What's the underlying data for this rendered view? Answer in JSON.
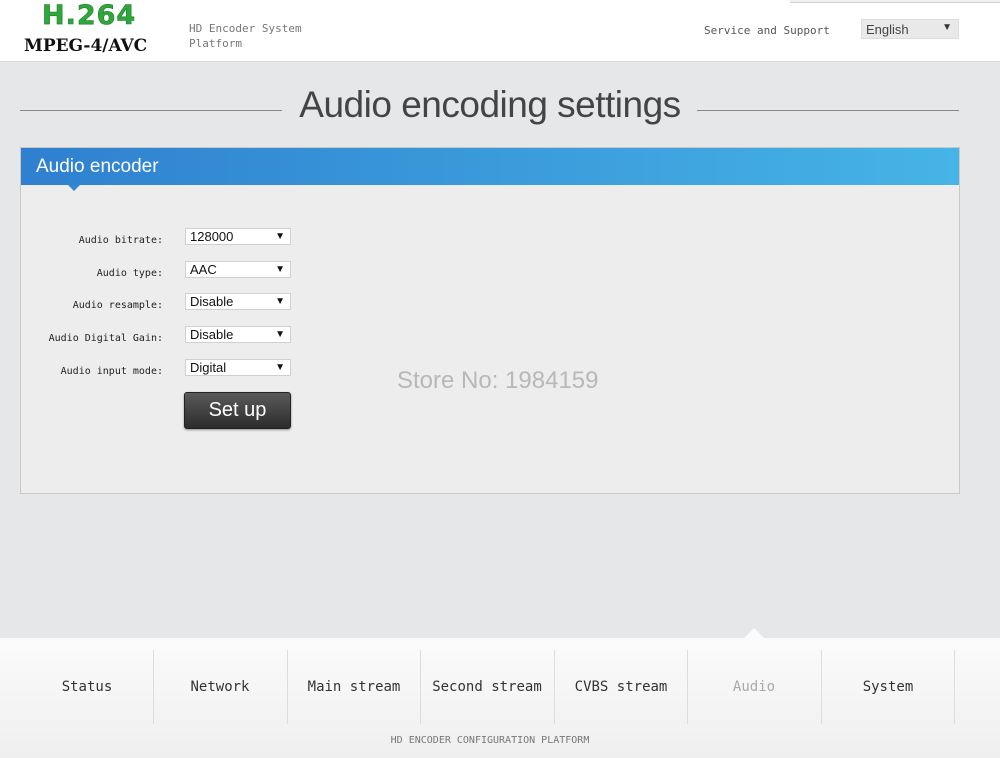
{
  "header": {
    "logo_main": "H.264",
    "logo_sub": "MPEG-4/AVC",
    "platform_line1": "HD Encoder System",
    "platform_line2": "Platform",
    "support_link": "Service and Support",
    "language": "English"
  },
  "page": {
    "title": "Audio encoding settings"
  },
  "panel": {
    "title": "Audio encoder",
    "fields": [
      {
        "label": "Audio bitrate:",
        "value": "128000"
      },
      {
        "label": "Audio type:",
        "value": "AAC"
      },
      {
        "label": "Audio resample:",
        "value": "Disable"
      },
      {
        "label": "Audio Digital Gain:",
        "value": "Disable"
      },
      {
        "label": "Audio input mode:",
        "value": "Digital"
      }
    ],
    "submit_label": "Set up",
    "watermark": "Store No: 1984159"
  },
  "nav": {
    "items": [
      {
        "label": "Status"
      },
      {
        "label": "Network"
      },
      {
        "label": "Main stream"
      },
      {
        "label": "Second stream"
      },
      {
        "label": "CVBS stream"
      },
      {
        "label": "Audio",
        "active": true
      },
      {
        "label": "System"
      }
    ],
    "footer": "HD ENCODER CONFIGURATION PLATFORM"
  },
  "colors": {
    "logo_green": "#2ea83a",
    "panel_head_start": "#2f80cf",
    "panel_head_end": "#46b4e6",
    "button_dark": "#2c2c2c"
  }
}
